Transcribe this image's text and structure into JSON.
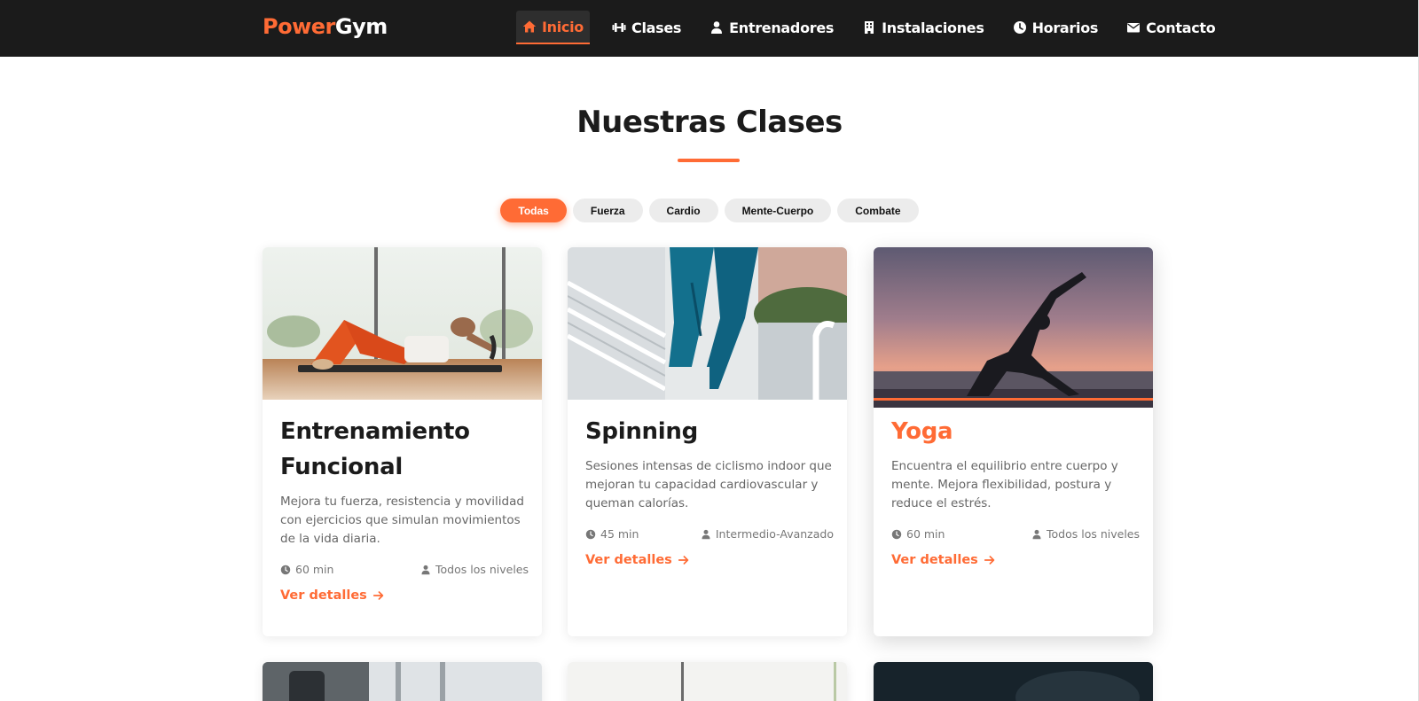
{
  "brand": {
    "part1": "Power",
    "part2": "Gym",
    "accent": "#ff6b35",
    "header_bg": "#1b1b1b"
  },
  "nav": [
    {
      "label": "Inicio",
      "icon": "home-icon",
      "active": true
    },
    {
      "label": "Clases",
      "icon": "dumbbell-icon",
      "active": false
    },
    {
      "label": "Entrenadores",
      "icon": "user-icon",
      "active": false
    },
    {
      "label": "Instalaciones",
      "icon": "building-icon",
      "active": false
    },
    {
      "label": "Horarios",
      "icon": "clock-icon",
      "active": false
    },
    {
      "label": "Contacto",
      "icon": "envelope-icon",
      "active": false
    }
  ],
  "section": {
    "title": "Nuestras Clases"
  },
  "filters": [
    {
      "label": "Todas",
      "active": true
    },
    {
      "label": "Fuerza",
      "active": false
    },
    {
      "label": "Cardio",
      "active": false
    },
    {
      "label": "Mente-Cuerpo",
      "active": false
    },
    {
      "label": "Combate",
      "active": false
    }
  ],
  "cards": [
    {
      "title": "Entrenamiento Funcional",
      "description": "Mejora tu fuerza, resistencia y movilidad con ejercicios que simulan movimientos de la vida diaria.",
      "duration": "60 min",
      "level": "Todos los niveles",
      "link": "Ver detalles"
    },
    {
      "title": "Spinning",
      "description": "Sesiones intensas de ciclismo indoor que mejoran tu capacidad cardiovascular y queman calorías.",
      "duration": "45 min",
      "level": "Intermedio-Avanzado",
      "link": "Ver detalles"
    },
    {
      "title": "Yoga",
      "description": "Encuentra el equilibrio entre cuerpo y mente. Mejora flexibilidad, postura y reduce el estrés.",
      "duration": "60 min",
      "level": "Todos los niveles",
      "link": "Ver detalles"
    }
  ]
}
